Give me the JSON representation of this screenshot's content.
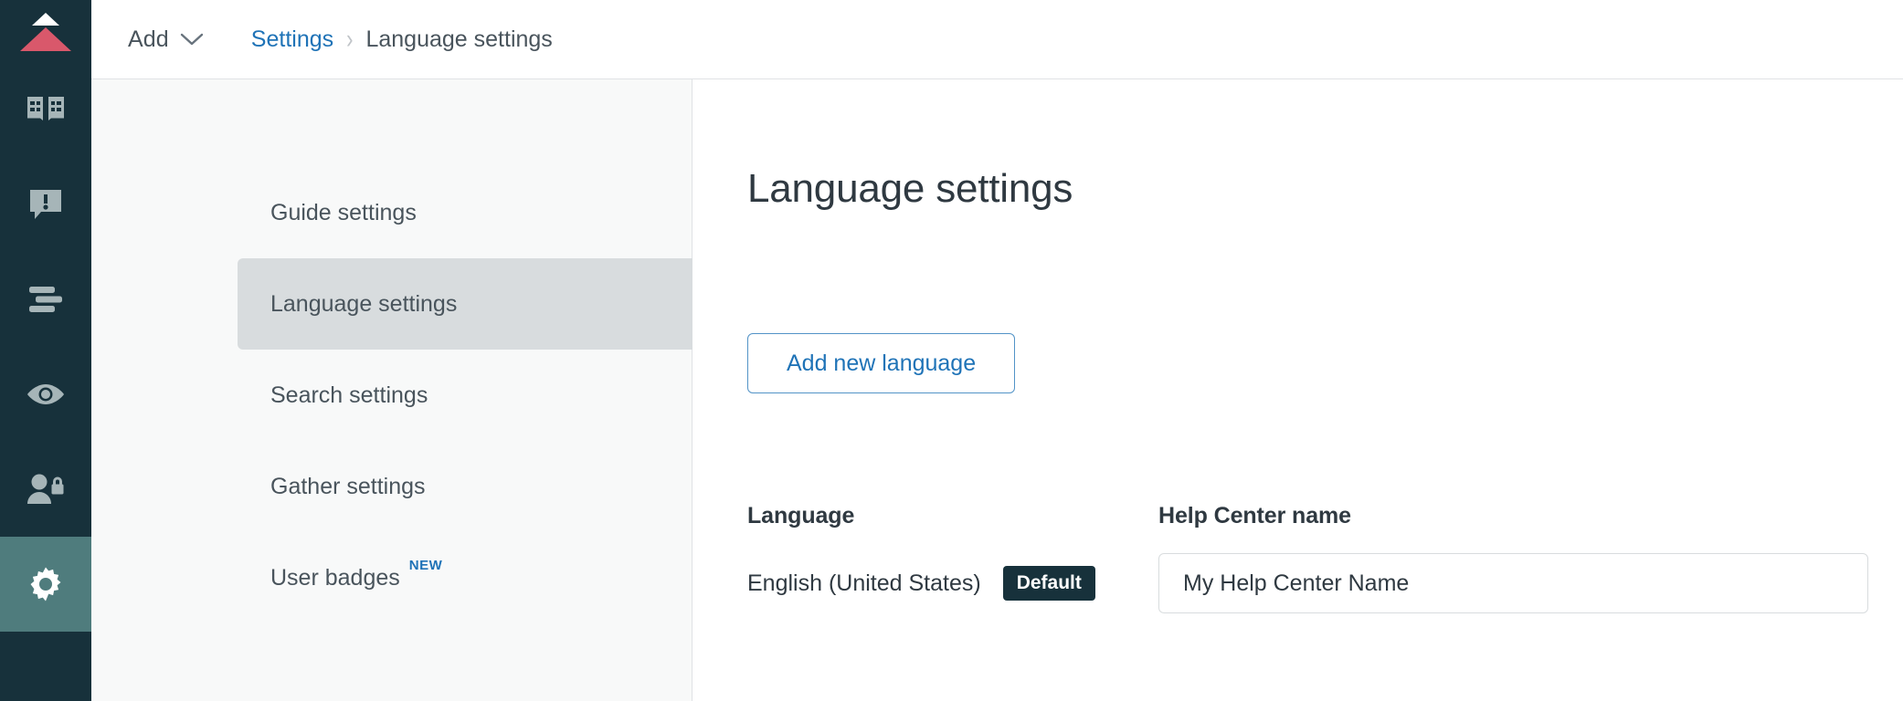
{
  "colors": {
    "rail_bg": "#17313b",
    "rail_active_bg": "#4f7c7d",
    "logo_red": "#d9586b",
    "accent_blue": "#1f73b7",
    "sidebar_bg": "#f8f9f9",
    "nav_selected_bg": "#d8dcde",
    "badge_dark": "#17313b",
    "text_primary": "#2f3941",
    "text_secondary": "#49545c"
  },
  "rail": {
    "logo_name": "zendesk-guide-logo",
    "items": [
      {
        "icon": "knowledge-base-book-icon",
        "active": false
      },
      {
        "icon": "community-post-icon",
        "active": false
      },
      {
        "icon": "arrange-articles-icon",
        "active": false
      },
      {
        "icon": "preview-eye-icon",
        "active": false
      },
      {
        "icon": "user-permissions-icon",
        "active": false
      },
      {
        "icon": "settings-gear-icon",
        "active": true
      }
    ]
  },
  "header": {
    "add_label": "Add",
    "add_chevron_icon": "chevron-down-icon",
    "breadcrumb": {
      "parent": "Settings",
      "separator": "›",
      "current": "Language settings"
    }
  },
  "sidebar": {
    "items": [
      {
        "label": "Guide settings",
        "selected": false,
        "badge": ""
      },
      {
        "label": "Language settings",
        "selected": true,
        "badge": ""
      },
      {
        "label": "Search settings",
        "selected": false,
        "badge": ""
      },
      {
        "label": "Gather settings",
        "selected": false,
        "badge": ""
      },
      {
        "label": "User badges",
        "selected": false,
        "badge": "NEW"
      }
    ]
  },
  "main": {
    "title": "Language settings",
    "add_language_button": "Add new language",
    "language_column": {
      "label": "Language",
      "rows": [
        {
          "name": "English (United States)",
          "badge": "Default"
        }
      ]
    },
    "help_center_column": {
      "label": "Help Center name",
      "input_value": "My Help Center Name",
      "input_placeholder": "My Help Center Name"
    }
  }
}
